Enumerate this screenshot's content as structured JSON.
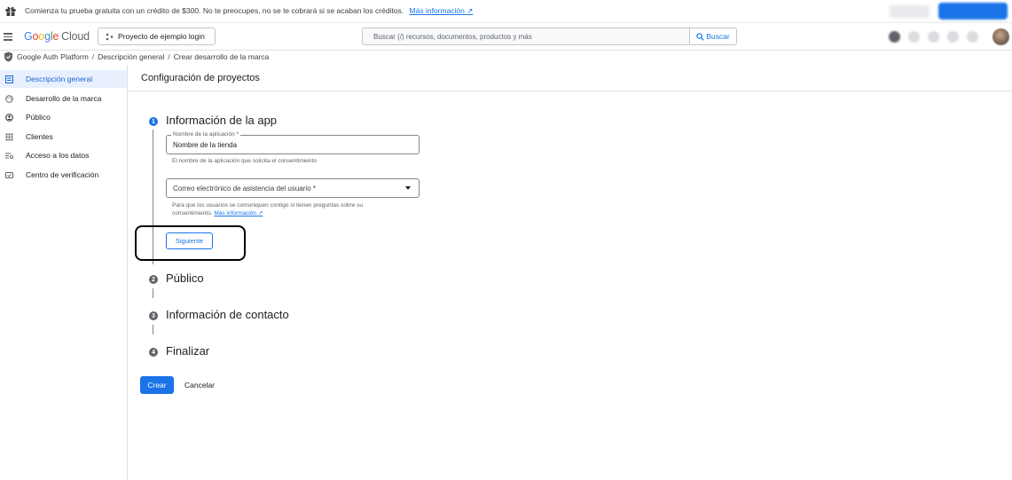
{
  "banner": {
    "text": "Comienza tu prueba gratuita con un crédito de $300. No te preocupes, no se te cobrará si se acaban los créditos.",
    "link": "Más información"
  },
  "header": {
    "logo_letters": [
      "G",
      "o",
      "o",
      "g",
      "l",
      "e"
    ],
    "logo_cloud": "Cloud",
    "project": "Proyecto de ejemplo login",
    "search_placeholder": "Buscar (/) recursos, documentos, productos y más",
    "search_button": "Buscar"
  },
  "breadcrumb": {
    "items": [
      "Google Auth Platform",
      "Descripción general",
      "Crear desarrollo de la marca"
    ],
    "separator": "/"
  },
  "sidebar": {
    "items": [
      {
        "label": "Descripción general",
        "icon": "dashboard-icon",
        "active": true
      },
      {
        "label": "Desarrollo de la marca",
        "icon": "palette-icon",
        "active": false
      },
      {
        "label": "Público",
        "icon": "person-icon",
        "active": false
      },
      {
        "label": "Clientes",
        "icon": "grid-icon",
        "active": false
      },
      {
        "label": "Acceso a los datos",
        "icon": "data-access-icon",
        "active": false
      },
      {
        "label": "Centro de verificación",
        "icon": "verification-icon",
        "active": false
      }
    ]
  },
  "main": {
    "title": "Configuración de proyectos",
    "steps": [
      {
        "number": "1",
        "title": "Información de la app"
      },
      {
        "number": "2",
        "title": "Público"
      },
      {
        "number": "3",
        "title": "Información de contacto"
      },
      {
        "number": "4",
        "title": "Finalizar"
      }
    ],
    "app_name_field": {
      "label": "Nombre de la aplicación *",
      "value": "Nombre de la tienda",
      "help": "El nombre de la aplicación que solicita el consentimiento"
    },
    "support_email": {
      "label": "Correo electrónico de asistencia del usuario *",
      "help": "Para que los usuarios se comuniquen contigo si tienen preguntas sobre su consentimiento.",
      "help_link": "Más información"
    },
    "next_button": "Siguiente",
    "create_button": "Crear",
    "cancel_button": "Cancelar"
  },
  "colors": {
    "primary": "#1a73e8",
    "active_nav_bg": "#e8f0fe"
  }
}
